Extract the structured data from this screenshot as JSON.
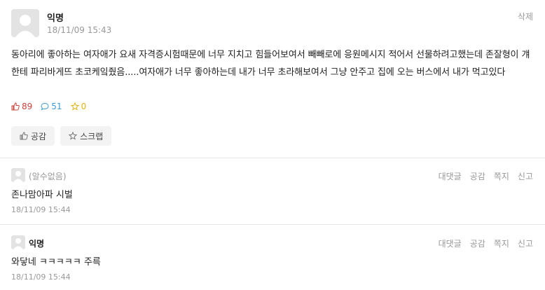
{
  "post": {
    "author": "익명",
    "time": "18/11/09 15:43",
    "delete_label": "삭제",
    "body": "동아리에 좋아하는 여자애가 요새 자격증시험때문에 너무 지치고 힘들어보여서 빼빼로에 응원메시지 적어서 선물하려고했는데 존잘형이 걔한테 파리바게뜨 초코케잌줬음.....여자애가 너무 좋아하는데 내가 너무 초라해보여서 그냥 안주고 집에 오는 버스에서 내가 먹고있다",
    "likes": "89",
    "comments": "51",
    "scraps": "0",
    "like_button": "공감",
    "scrap_button": "스크랩"
  },
  "comments": [
    {
      "author": "(알수없음)",
      "text": "존나맘아파 시벌",
      "time": "18/11/09 15:44",
      "actions": [
        "대댓글",
        "공감",
        "쪽지",
        "신고"
      ]
    },
    {
      "author": "익명",
      "text": "와닿네 ㅋㅋㅋㅋㅋ 주륵",
      "time": "18/11/09 15:44",
      "actions": [
        "대댓글",
        "공감",
        "쪽지",
        "신고"
      ]
    }
  ],
  "colors": {
    "like": "#c8433a",
    "comment": "#3b9bd6",
    "scrap": "#e3b315"
  }
}
